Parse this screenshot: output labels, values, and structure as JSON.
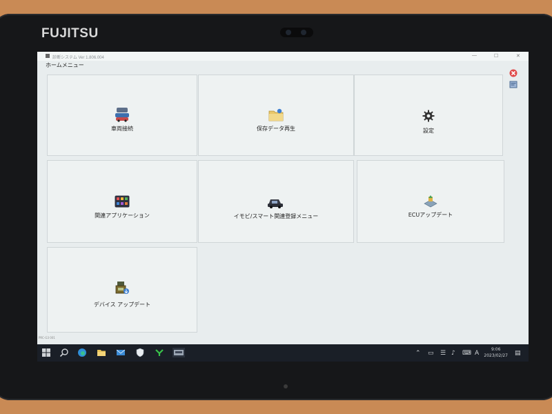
{
  "device": {
    "brand": "FUJITSU"
  },
  "window": {
    "title": "診断システム Ver 1.806.004",
    "minimize": "—",
    "maximize": "☐",
    "close": "✕"
  },
  "menu": {
    "name": "ホームメニュー"
  },
  "tiles": [
    {
      "label": "車両接続",
      "icon": "vehicle-connect-icon"
    },
    {
      "label": "保存データ再生",
      "icon": "folder-playback-icon"
    },
    {
      "label": "設定",
      "icon": "gear-icon"
    },
    {
      "label": "関連アプリケーション",
      "icon": "app-grid-icon"
    },
    {
      "label": "イモビ/スマート関連登録メニュー",
      "icon": "car-key-icon"
    },
    {
      "label": "ECUアップデート",
      "icon": "ecu-update-icon"
    },
    {
      "label": "デバイス アップデート",
      "icon": "device-update-icon"
    }
  ],
  "side_icons": [
    "exit-icon",
    "help-icon"
  ],
  "status_text": "PRC-G3 001",
  "taskbar": {
    "tray_ime": "A",
    "time": "9:06",
    "date": "2023/02/27"
  },
  "colors": {
    "accent": "#1a1f27",
    "tile_bg": "#eef2f2",
    "screen_bg": "#e8edee"
  }
}
